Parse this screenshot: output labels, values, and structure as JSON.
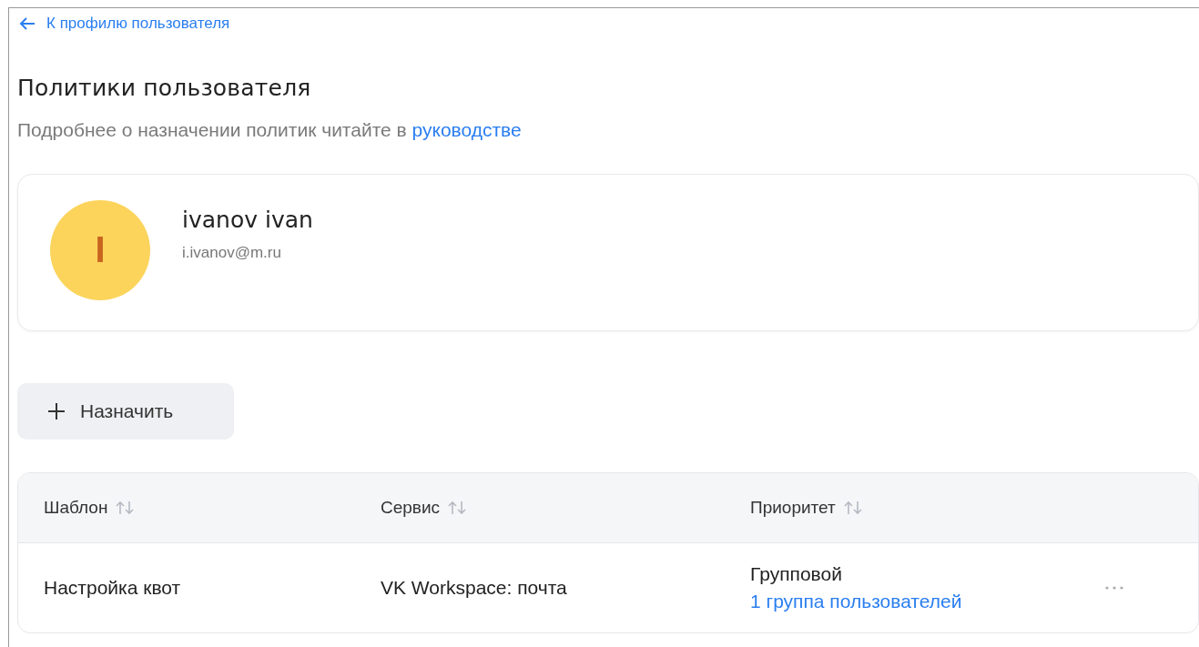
{
  "back_link": {
    "label": "К профилю пользователя"
  },
  "title": "Политики пользователя",
  "subtitle": {
    "text": "Подробнее о назначении политик читайте в",
    "link": "руководстве"
  },
  "user": {
    "initial": "I",
    "name": "ivanov ivan",
    "email": "i.ivanov@m.ru",
    "color": "#fcd45c"
  },
  "assign_button": {
    "label": "Назначить"
  },
  "table": {
    "columns": [
      {
        "label": "Шаблон",
        "sortable": true
      },
      {
        "label": "Сервис",
        "sortable": true
      },
      {
        "label": "Приоритет",
        "sortable": true
      }
    ],
    "rows": [
      {
        "template": "Настройка квот",
        "service": "VK Workspace: почта",
        "priority": "Групповой",
        "priority_link": "1 группа пользователей"
      }
    ]
  }
}
